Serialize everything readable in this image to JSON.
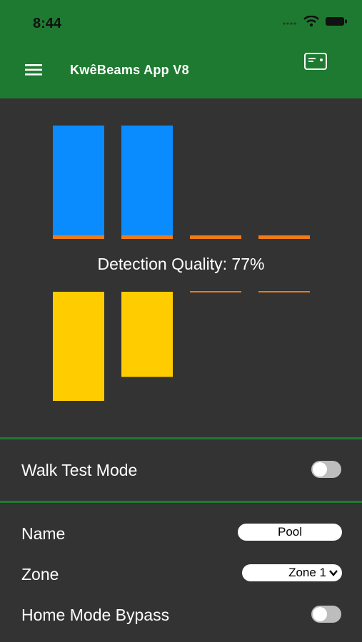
{
  "status_bar": {
    "time": "8:44"
  },
  "header": {
    "title": "KwêBeams App V8"
  },
  "meter": {
    "quality_label": "Detection Quality: 77%",
    "blue_bars": [
      1.0,
      1.0,
      0.0,
      0.0
    ],
    "yellow_bars": [
      1.0,
      0.78,
      0.0,
      0.0
    ],
    "colors": {
      "blue": "#0a8cff",
      "yellow": "#ffcc00",
      "orange": "#f07a14"
    }
  },
  "walk_test": {
    "label": "Walk Test Mode",
    "enabled": false
  },
  "settings": {
    "name_label": "Name",
    "name_value": "Pool",
    "zone_label": "Zone",
    "zone_value": "Zone 1",
    "home_bypass_label": "Home Mode Bypass",
    "home_bypass_enabled": false
  }
}
